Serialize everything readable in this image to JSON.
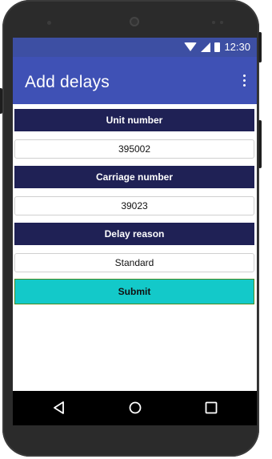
{
  "status_bar": {
    "time": "12:30",
    "icons": [
      "wifi-icon",
      "signal-icon",
      "battery-icon"
    ]
  },
  "app_bar": {
    "title": "Add delays",
    "menu_icon": "overflow-menu-icon"
  },
  "form": {
    "unit_label": "Unit number",
    "unit_value": "395002",
    "carriage_label": "Carriage number",
    "carriage_value": "39023",
    "reason_label": "Delay reason",
    "reason_value": "Standard",
    "submit_label": "Submit"
  },
  "nav_bar": {
    "icons": [
      "back-icon",
      "home-icon",
      "recents-icon"
    ]
  },
  "colors": {
    "status_bar": "#3d4fa3",
    "app_bar": "#3f51b5",
    "label_bar": "#1f2155",
    "submit": "#13c9c9",
    "nav_bar": "#000000"
  }
}
